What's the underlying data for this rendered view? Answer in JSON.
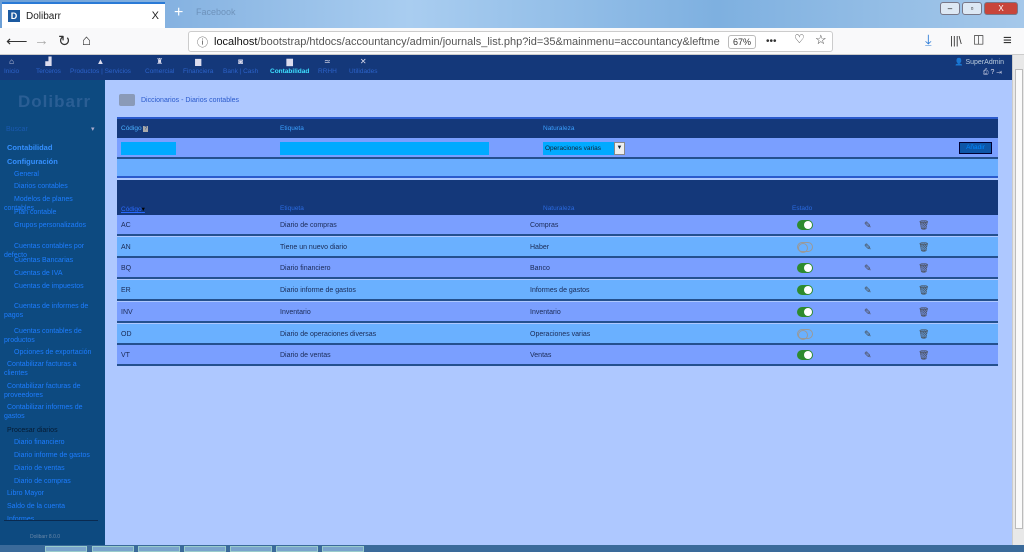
{
  "browser": {
    "tab_title": "Dolibarr",
    "tab_close": "X",
    "new_tab": "+",
    "second_tab": "Facebook",
    "url_host": "localhost",
    "url_path": "/bootstrap/htdocs/accountancy/admin/journals_list.php?id=35&mainmenu=accountancy&leftme",
    "zoom": "67%",
    "more": "•••"
  },
  "topmenu": {
    "items": [
      {
        "label": "Inicio",
        "icon": "home-icon"
      },
      {
        "label": "Terceros",
        "icon": "company-icon"
      },
      {
        "label": "Productos | Servicios",
        "icon": "product-icon"
      },
      {
        "label": "Comercial",
        "icon": "commercial-icon"
      },
      {
        "label": "Financiera",
        "icon": "billing-icon"
      },
      {
        "label": "Bank | Cash",
        "icon": "bank-icon"
      },
      {
        "label": "Contabilidad",
        "icon": "accountancy-icon",
        "active": true
      },
      {
        "label": "RRHH",
        "icon": "hrm-icon"
      },
      {
        "label": "Utilidades",
        "icon": "tools-icon"
      }
    ],
    "user": "SuperAdmin"
  },
  "sidebar": {
    "logo": "Dolibarr",
    "search": "Buscar",
    "items": [
      {
        "label": "Contabilidad",
        "level": 0,
        "style": "h"
      },
      {
        "label": "Configuración",
        "level": 0,
        "style": "h"
      },
      {
        "label": "General",
        "level": 1
      },
      {
        "label": "Diarios contables",
        "level": 1
      },
      {
        "label": "Modelos de planes contables",
        "level": 1
      },
      {
        "label": "Plan contable",
        "level": 1
      },
      {
        "label": "Grupos personalizados",
        "level": 1
      },
      {
        "label": "Cuentas contables por defecto",
        "level": 1
      },
      {
        "label": "Cuentas Bancarias",
        "level": 1
      },
      {
        "label": "Cuentas de IVA",
        "level": 1
      },
      {
        "label": "Cuentas de impuestos",
        "level": 1
      },
      {
        "label": "Cuentas de informes de pagos",
        "level": 1
      },
      {
        "label": "Cuentas contables de productos",
        "level": 1
      },
      {
        "label": "Opciones de exportación",
        "level": 1
      },
      {
        "label": "Contabilizar facturas a clientes",
        "level": 0
      },
      {
        "label": "Contabilizar facturas de proveedores",
        "level": 0
      },
      {
        "label": "Contabilizar informes de gastos",
        "level": 0
      },
      {
        "label": "Procesar diarios",
        "level": 0,
        "style": "dark"
      },
      {
        "label": "Diario financiero",
        "level": 1
      },
      {
        "label": "Diario informe de gastos",
        "level": 1
      },
      {
        "label": "Diario de ventas",
        "level": 1
      },
      {
        "label": "Diario de compras",
        "level": 1
      },
      {
        "label": "Libro Mayor",
        "level": 0
      },
      {
        "label": "Saldo de la cuenta",
        "level": 0
      },
      {
        "label": "Informes",
        "level": 0
      }
    ],
    "version": "Dolibarr 8.0.0"
  },
  "breadcrumb": "Diccionarios - Diarios contables",
  "add_form": {
    "headers": {
      "code": "Código",
      "label": "Etiqueta",
      "nature": "Naturaleza"
    },
    "code_value": "",
    "label_value": "",
    "nature_selected": "Operaciones varias",
    "add_button": "Añadir"
  },
  "list": {
    "headers": {
      "code": "Código",
      "label": "Etiqueta",
      "nature": "Naturaleza",
      "status": "Estado"
    },
    "rows": [
      {
        "code": "AC",
        "label": "Diario de compras",
        "nature": "Compras",
        "active": true
      },
      {
        "code": "AN",
        "label": "Tiene un nuevo diario",
        "nature": "Haber",
        "active": false
      },
      {
        "code": "BQ",
        "label": "Diario financiero",
        "nature": "Banco",
        "active": true
      },
      {
        "code": "ER",
        "label": "Diario informe de gastos",
        "nature": "Informes de gastos",
        "active": true
      },
      {
        "code": "INV",
        "label": "Inventario",
        "nature": "Inventario",
        "active": true
      },
      {
        "code": "OD",
        "label": "Diario de operaciones diversas",
        "nature": "Operaciones varias",
        "active": false
      },
      {
        "code": "VT",
        "label": "Diario de ventas",
        "nature": "Ventas",
        "active": true
      }
    ]
  }
}
